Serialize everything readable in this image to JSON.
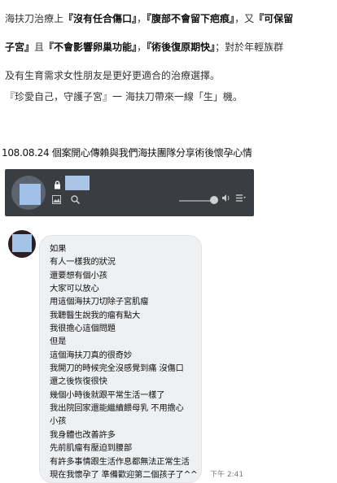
{
  "article": {
    "line1_a": "海扶刀治療上",
    "line1_b": "『沒有任合傷口』",
    "line1_c": "，",
    "line1_d": "『腹部不會留下疤痕』",
    "line1_e": "，又",
    "line1_f": "『可保留",
    "line2_a": "子宮』",
    "line2_b": "且",
    "line2_c": "『不會影響卵巢功能』",
    "line2_d": "，",
    "line2_e": "『術後復原期快』",
    "line2_f": "；對於年輕族群",
    "line3": "及有生育需求女性朋友是更好更適合的治療選擇。",
    "quote": "『珍愛自己，守護子宮』一 海扶刀帶來一線「生」機。",
    "caption": "108.08.24 個案開心傳賴與我們海扶團隊分享術後懷孕心情"
  },
  "chat": {
    "header_icons": {
      "lock": "lock-icon",
      "gallery": "gallery-icon",
      "search": "search-icon",
      "volume": "volume-icon",
      "menu": "menu-icon"
    },
    "message_lines": [
      "如果",
      "有人一樣我的狀況",
      "還要想有個小孩",
      "大家可以放心",
      "用這個海扶刀切除子宮肌瘤",
      "我聽醫生說我的瘤有點大",
      "我很擔心這個問題",
      "但是",
      "這個海扶刀真的很奇妙",
      "我開刀的時候完全沒感覺到痛 沒傷口",
      "還之後恢復很快",
      "幾個小時後就跟平常生活一樣了",
      "我出院回家還能繼續餵母乳 不用擔心",
      "小孩",
      "我身體也改善許多",
      "先前肌瘤有壓迫到腰部",
      "有許多事情跟生活作息都無法正常生活",
      "現在我懷孕了 準備歡迎第二個孩子了^^"
    ],
    "timestamp": "下午 2:41"
  },
  "colors": {
    "header_bg": "#3a3d42",
    "bubble_bg": "#eef0f2",
    "placeholder_blue": "#a5c3e7"
  }
}
